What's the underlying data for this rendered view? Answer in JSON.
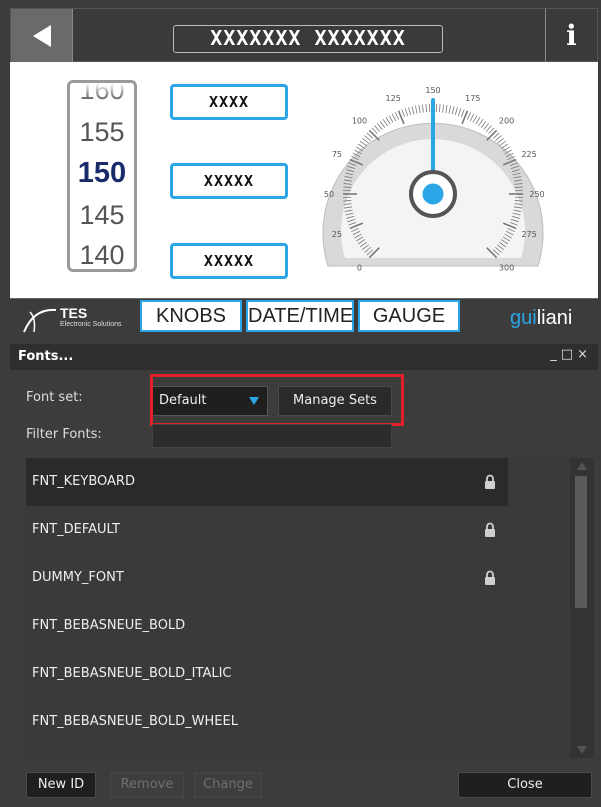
{
  "preview": {
    "title": "XXXXXXX XXXXXXX",
    "info_label": "i",
    "wheel_values": [
      "160",
      "155",
      "150",
      "145",
      "140"
    ],
    "labels": [
      "XXXX",
      "XXXXX",
      "XXXXX"
    ],
    "gauge": {
      "tick_labels": [
        "0",
        "25",
        "50",
        "75",
        "100",
        "125",
        "150",
        "175",
        "200",
        "225",
        "250",
        "275",
        "300"
      ],
      "min": 0,
      "max": 300,
      "value": 150
    },
    "logo": {
      "word": "TES",
      "sub": "Electronic Solutions"
    },
    "nav": {
      "knobs": "KNOBS",
      "datetime": "DATE/TIME",
      "gauge": "GAUGE"
    },
    "brand": {
      "gui": "gui",
      "liani": "liani"
    }
  },
  "panel": {
    "title": "Fonts...",
    "controls": {
      "minimize": "_",
      "maximize": "□",
      "close": "×"
    },
    "font_set_label": "Font set:",
    "font_set_value": "Default",
    "manage_sets_label": "Manage Sets",
    "filter_label": "Filter Fonts:",
    "filter_value": "",
    "fonts": [
      {
        "name": "FNT_KEYBOARD",
        "locked": true,
        "selected": true
      },
      {
        "name": "FNT_DEFAULT",
        "locked": true,
        "selected": false
      },
      {
        "name": "DUMMY_FONT",
        "locked": true,
        "selected": false
      },
      {
        "name": "FNT_BEBASNEUE_BOLD",
        "locked": false,
        "selected": false
      },
      {
        "name": "FNT_BEBASNEUE_BOLD_ITALIC",
        "locked": false,
        "selected": false
      },
      {
        "name": "FNT_BEBASNEUE_BOLD_WHEEL",
        "locked": false,
        "selected": false
      }
    ],
    "buttons": {
      "new_id": "New ID",
      "remove": "Remove",
      "change": "Change",
      "close": "Close"
    }
  },
  "colors": {
    "accent": "#2aa5e6",
    "highlight": "#e2202a",
    "panel_bg": "#3c3c3c"
  }
}
